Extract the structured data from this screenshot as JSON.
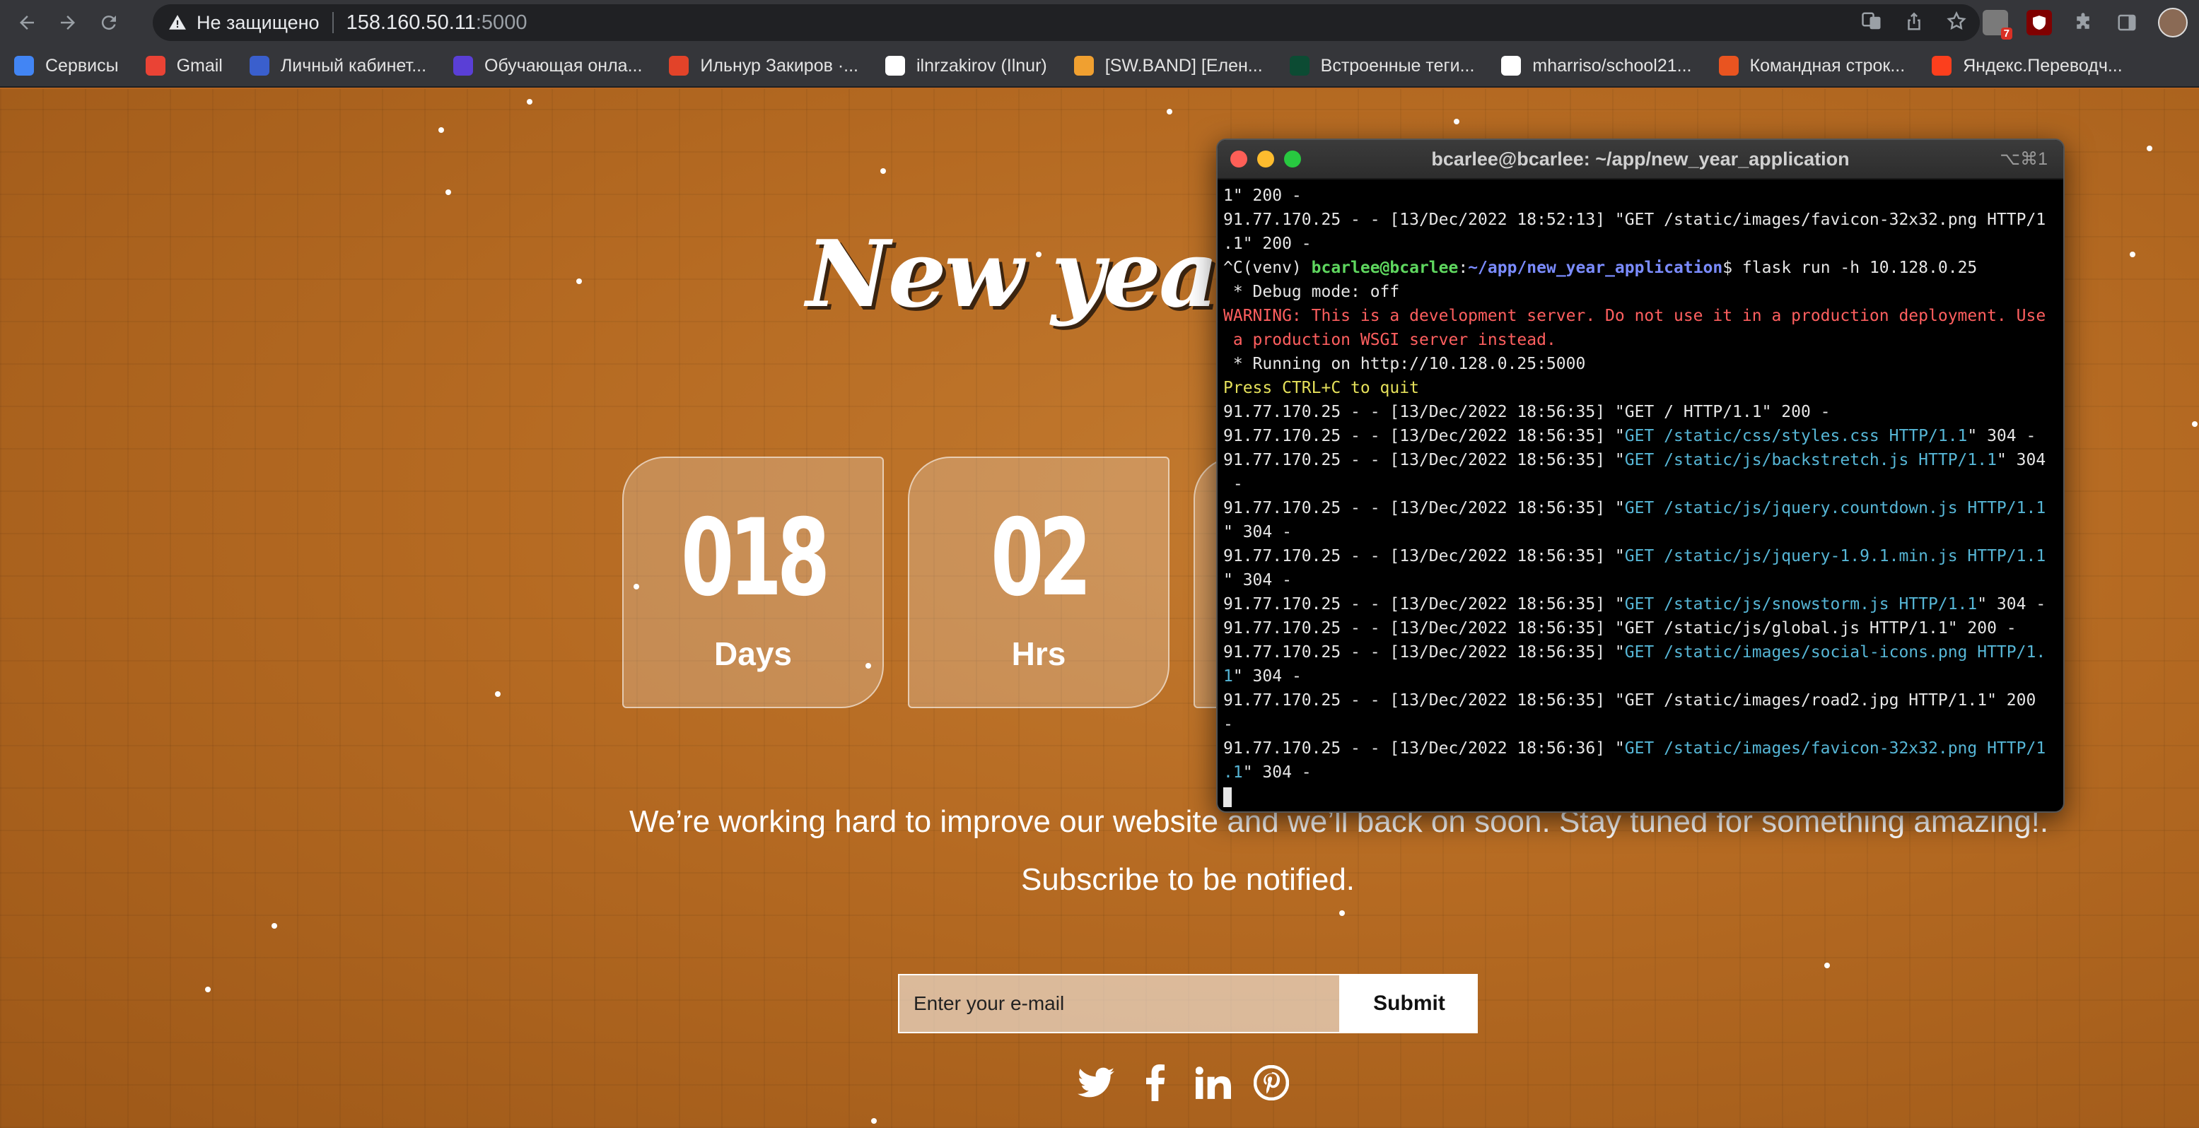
{
  "browser": {
    "security_label": "Не защищено",
    "url_host": "158.160.50.11",
    "url_port": ":5000",
    "ext_badge": "7"
  },
  "bookmarks": [
    {
      "label": "Сервисы",
      "icon": "apps-grid-icon",
      "color": "#4285f4"
    },
    {
      "label": "Gmail",
      "icon": "gmail-icon",
      "color": "#ea4335"
    },
    {
      "label": "Личный кабинет...",
      "icon": "emblem-icon",
      "color": "#3a5fcd"
    },
    {
      "label": "Обучающая онла...",
      "icon": "s-icon",
      "color": "#5a3fd6"
    },
    {
      "label": "Ильнур Закиров ·...",
      "icon": "gitlab-icon",
      "color": "#e24329"
    },
    {
      "label": "ilnrzakirov (Ilnur)",
      "icon": "github-icon",
      "color": "#ffffff"
    },
    {
      "label": "[SW.BAND] [Елен...",
      "icon": "cloud-icon",
      "color": "#f0a030"
    },
    {
      "label": "Встроенные теги...",
      "icon": "django-icon",
      "color": "#0c4b33"
    },
    {
      "label": "mharriso/school21...",
      "icon": "github-icon",
      "color": "#ffffff"
    },
    {
      "label": "Командная строк...",
      "icon": "ubuntu-icon",
      "color": "#e95420"
    },
    {
      "label": "Яндекс.Переводч...",
      "icon": "yandex-translate-icon",
      "color": "#fc3f1d"
    }
  ],
  "page": {
    "title": "New year co",
    "countdown": [
      {
        "value": "018",
        "label": "Days"
      },
      {
        "value": "02",
        "label": "Hrs"
      }
    ],
    "tagline": "We’re working hard to improve our website and we’ll back on soon. Stay tuned for something amazing!.",
    "subscribe": "Subscribe to be notified.",
    "email_placeholder": "Enter your e-mail",
    "submit_label": "Submit",
    "social": [
      "twitter-icon",
      "facebook-icon",
      "linkedin-icon",
      "pinterest-icon"
    ]
  },
  "terminal": {
    "title": "bcarlee@bcarlee: ~/app/new_year_application",
    "shortcut": "⌥⌘1",
    "lines": [
      [
        {
          "t": "1\" 200 -"
        }
      ],
      [
        {
          "t": "91.77.170.25 - - [13/Dec/2022 18:52:13] \"GET /static/images/favicon-32x32.png HTTP/1"
        }
      ],
      [
        {
          "t": ".1\" 200 -"
        }
      ],
      [
        {
          "t": "^C(venv) "
        },
        {
          "t": "bcarlee@bcarlee",
          "c": "green"
        },
        {
          "t": ":"
        },
        {
          "t": "~/app/new_year_application",
          "c": "blue"
        },
        {
          "t": "$ flask run -h 10.128.0.25"
        }
      ],
      [
        {
          "t": " * Debug mode: off"
        }
      ],
      [
        {
          "t": "WARNING: This is a development server. Do not use it in a production deployment. Use",
          "c": "red"
        }
      ],
      [
        {
          "t": " a production WSGI server instead.",
          "c": "red"
        }
      ],
      [
        {
          "t": " * Running on http://10.128.0.25:5000"
        }
      ],
      [
        {
          "t": "Press CTRL+C to quit",
          "c": "yellow"
        }
      ],
      [
        {
          "t": "91.77.170.25 - - [13/Dec/2022 18:56:35] \"GET / HTTP/1.1\" 200 -"
        }
      ],
      [
        {
          "t": "91.77.170.25 - - [13/Dec/2022 18:56:35] \""
        },
        {
          "t": "GET /static/css/styles.css HTTP/1.1",
          "c": "cyan"
        },
        {
          "t": "\" 304 -"
        }
      ],
      [
        {
          "t": "91.77.170.25 - - [13/Dec/2022 18:56:35] \""
        },
        {
          "t": "GET /static/js/backstretch.js HTTP/1.1",
          "c": "cyan"
        },
        {
          "t": "\" 304"
        }
      ],
      [
        {
          "t": " -"
        }
      ],
      [
        {
          "t": "91.77.170.25 - - [13/Dec/2022 18:56:35] \""
        },
        {
          "t": "GET /static/js/jquery.countdown.js HTTP/1.1",
          "c": "cyan"
        }
      ],
      [
        {
          "t": "\" 304 -"
        }
      ],
      [
        {
          "t": "91.77.170.25 - - [13/Dec/2022 18:56:35] \""
        },
        {
          "t": "GET /static/js/jquery-1.9.1.min.js HTTP/1.1",
          "c": "cyan"
        }
      ],
      [
        {
          "t": "\" 304 -"
        }
      ],
      [
        {
          "t": "91.77.170.25 - - [13/Dec/2022 18:56:35] \""
        },
        {
          "t": "GET /static/js/snowstorm.js HTTP/1.1",
          "c": "cyan"
        },
        {
          "t": "\" 304 -"
        }
      ],
      [
        {
          "t": "91.77.170.25 - - [13/Dec/2022 18:56:35] \"GET /static/js/global.js HTTP/1.1\" 200 -"
        }
      ],
      [
        {
          "t": "91.77.170.25 - - [13/Dec/2022 18:56:35] \""
        },
        {
          "t": "GET /static/images/social-icons.png HTTP/1.",
          "c": "cyan"
        }
      ],
      [
        {
          "t": "1",
          "c": "cyan"
        },
        {
          "t": "\" 304 -"
        }
      ],
      [
        {
          "t": "91.77.170.25 - - [13/Dec/2022 18:56:35] \"GET /static/images/road2.jpg HTTP/1.1\" 200"
        }
      ],
      [
        {
          "t": "-"
        }
      ],
      [
        {
          "t": "91.77.170.25 - - [13/Dec/2022 18:56:36] \""
        },
        {
          "t": "GET /static/images/favicon-32x32.png HTTP/1",
          "c": "cyan"
        }
      ],
      [
        {
          "t": ".1",
          "c": "cyan"
        },
        {
          "t": "\" 304 -"
        }
      ]
    ]
  }
}
